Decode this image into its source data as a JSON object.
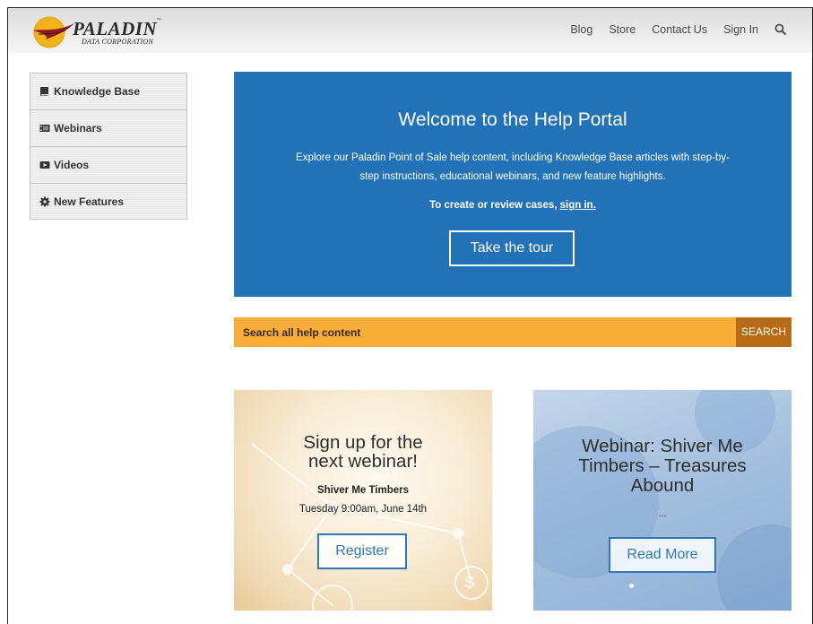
{
  "brand": {
    "name": "PALADIN",
    "tm": "™",
    "subtitle": "DATA CORPORATION"
  },
  "topnav": {
    "items": [
      "Blog",
      "Store",
      "Contact Us",
      "Sign In"
    ],
    "search_icon": "search-icon"
  },
  "sidebar": {
    "items": [
      {
        "label": "Knowledge Base",
        "icon": "book-icon"
      },
      {
        "label": "Webinars",
        "icon": "film-icon"
      },
      {
        "label": "Videos",
        "icon": "video-camera-icon"
      },
      {
        "label": "New Features",
        "icon": "gear-icon"
      }
    ]
  },
  "hero": {
    "title": "Welcome to the Help Portal",
    "text_line1": "Explore our Paladin Point of Sale help content, including Knowledge Base articles with step-by-",
    "text_line2": "step instructions, educational webinars, and new feature highlights.",
    "cta_text": "To create or review cases, ",
    "cta_link": "sign in.",
    "tour_button": "Take the tour"
  },
  "search": {
    "placeholder": "Search all help content",
    "button": "SEARCH"
  },
  "cards": {
    "left": {
      "title_line1": "Sign up for the",
      "title_line2": "next webinar!",
      "event_name": "Shiver Me Timbers",
      "event_time": "Tuesday 9:00am, June 14th",
      "button": "Register"
    },
    "right": {
      "title_line1": "Webinar: Shiver Me",
      "title_line2": "Timbers – Treasures",
      "title_line3": "Abound",
      "ellipsis": "...",
      "button": "Read More",
      "carousel_dots": 5,
      "active_dot": 1
    }
  },
  "colors": {
    "hero_bg": "#2272b7",
    "search_bg": "#f9ad39",
    "search_button_bg": "#b86b13",
    "button_border": "#2f78b8"
  }
}
